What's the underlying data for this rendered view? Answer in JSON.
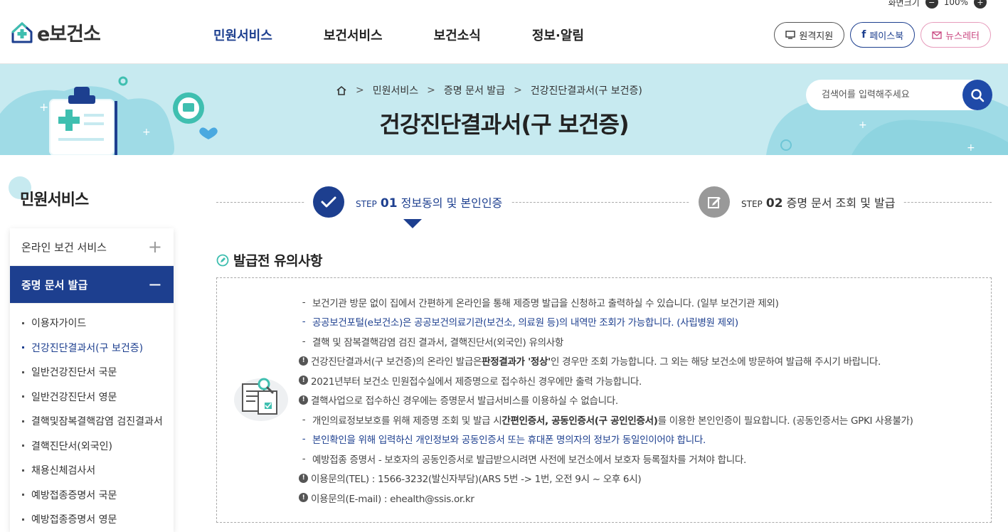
{
  "top_util": {
    "label": "화면크기",
    "zoom": "100%"
  },
  "header": {
    "logo_text": "e보건소",
    "nav": [
      "민원서비스",
      "보건서비스",
      "보건소식",
      "정보·알림"
    ],
    "buttons": {
      "remote": "원격지원",
      "facebook": "페이스북",
      "newsletter": "뉴스레터"
    }
  },
  "banner": {
    "breadcrumb": [
      "민원서비스",
      "증명 문서 발급",
      "건강진단결과서(구 보건증)"
    ],
    "title": "건강진단결과서(구 보건증)",
    "search_placeholder": "검색어를 입력해주세요"
  },
  "sidebar": {
    "title": "민원서비스",
    "menu": [
      {
        "label": "온라인 보건 서비스",
        "toggle": "+"
      },
      {
        "label": "증명 문서 발급",
        "toggle": "−"
      }
    ],
    "submenu": [
      "이용자가이드",
      "건강진단결과서(구 보건증)",
      "일반건강진단서 국문",
      "일반건강진단서 영문",
      "결핵및잠복결핵감염 검진결과서",
      "결핵진단서(외국인)",
      "채용신체검사서",
      "예방접종증명서 국문",
      "예방접종증명서 영문"
    ]
  },
  "steps": [
    {
      "prefix": "STEP",
      "num": "01",
      "label": "정보동의 및 본인인증"
    },
    {
      "prefix": "STEP",
      "num": "02",
      "label": "증명 문서 조회 및 발급"
    }
  ],
  "notice": {
    "title": "발급전 유의사항",
    "items": [
      {
        "mark": "-",
        "text": "보건기관 방문 없이 집에서 간편하게 온라인을 통해 제증명 발급을 신청하고 출력하실 수 있습니다. (일부 보건기관 제외)"
      },
      {
        "mark": "-",
        "text": "공공보건포털(e보건소)은 공공보건의료기관(보건소, 의료원 등)의 내역만 조회가 가능합니다. (사립병원 제외)"
      },
      {
        "mark": "-",
        "text": "결핵 및 잠복결핵감염 검진 결과서, 결핵진단서(외국인) 유의사항"
      },
      {
        "mark": "!",
        "pre": "건강진단결과서(구 보건증)의 온라인 발급은 ",
        "bold": "판정결과가 '정상'",
        "post": "인 경우만 조회 가능합니다. 그 외는 해당 보건소에 방문하여 발급해 주시기 바랍니다."
      },
      {
        "mark": "!",
        "text": "2021년부터 보건소 민원접수실에서 제증명으로 접수하신 경우에만 출력 가능합니다."
      },
      {
        "mark": "!",
        "text": "결핵사업으로 접수하신 경우에는 증명문서 발급서비스를 이용하실 수 없습니다."
      },
      {
        "mark": "-",
        "pre": "개인의료정보보호를 위해 제증명 조회 및 발급 시 ",
        "bold": "간편인증서, 공동인증서(구 공인인증서)",
        "post": "를 이용한 본인인증이 필요합니다. (공동인증서는 GPKI 사용불가)"
      },
      {
        "mark": "-",
        "text": "본인확인을 위해 입력하신 개인정보와 공동인증서 또는 휴대폰 명의자의 정보가 동일인이어야 합니다."
      },
      {
        "mark": "-",
        "text": "예방접종 증명서 - 보호자의 공동인증서로 발급받으시려면 사전에 보건소에서 보호자 등록절차를 거쳐야 합니다."
      },
      {
        "mark": "!",
        "text": "이용문의(TEL) : 1566-3232(발신자부담)(ARS 5번 -> 1번, 오전 9시 ~ 오후 6시)"
      },
      {
        "mark": "!",
        "text": "이용문의(E-mail) : ehealth@ssis.or.kr"
      }
    ]
  },
  "colors": {
    "primary": "#1d3f8f",
    "banner_bg": "#c7eaf0",
    "accent_teal": "#3fbfb0",
    "search_btn": "#1f4aa8"
  }
}
